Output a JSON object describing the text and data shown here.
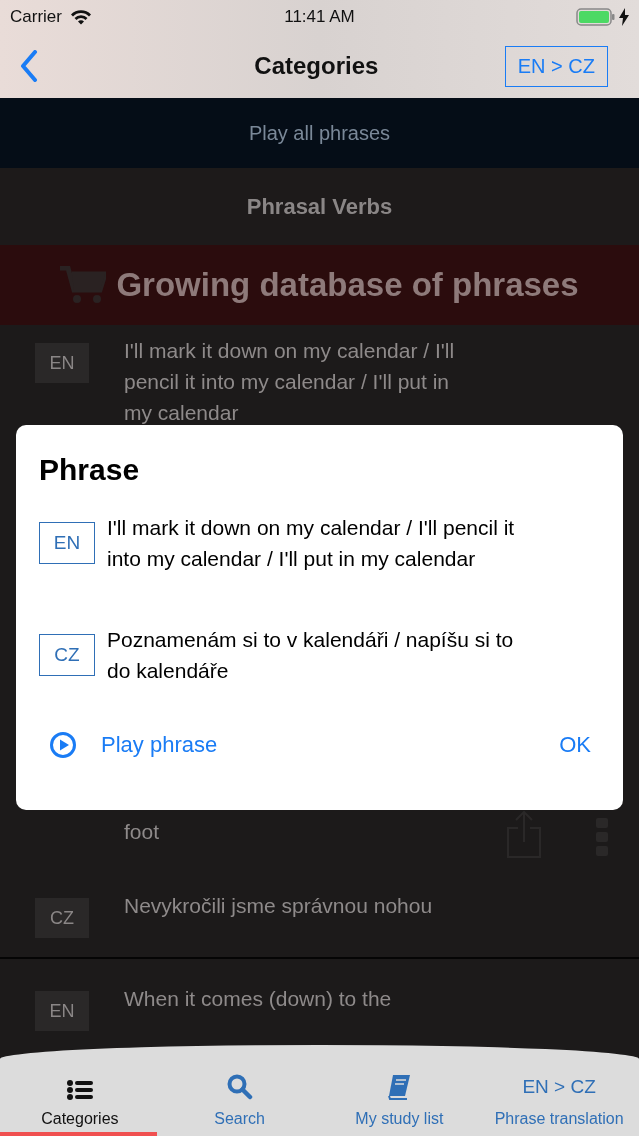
{
  "status_bar": {
    "carrier": "Carrier",
    "time": "11:41 AM"
  },
  "nav": {
    "title": "Categories",
    "language_button": "EN > CZ"
  },
  "list": {
    "play_all": "Play all phrases",
    "category_title": "Phrasal Verbs",
    "promo": "Growing database of phrases"
  },
  "rows": [
    {
      "kind": "entry",
      "lang": "EN",
      "text": "I'll mark it down on my calendar / I'll pencil it into my calendar / I'll put in my calendar"
    },
    {
      "kind": "gap"
    },
    {
      "kind": "tail",
      "text": "foot"
    },
    {
      "kind": "entry",
      "lang": "CZ",
      "text": "Nevykročili jsme správnou nohou"
    },
    {
      "kind": "divider"
    },
    {
      "kind": "entry",
      "lang": "EN",
      "text": "When it comes (down) to the"
    }
  ],
  "dialog": {
    "title": "Phrase",
    "entries": [
      {
        "lang": "EN",
        "text": "I'll mark it down on my calendar / I'll pencil it into my calendar / I'll put in my calendar"
      },
      {
        "lang": "CZ",
        "text": "Poznamenám si to v kalendáři / napíšu si to do kalendáře"
      }
    ],
    "play": "Play phrase",
    "ok": "OK"
  },
  "tab_bar": [
    {
      "kind": "list",
      "label": "Categories",
      "selected": true
    },
    {
      "kind": "search",
      "label": "Search",
      "selected": false
    },
    {
      "kind": "book",
      "label": "My study list",
      "selected": false
    },
    {
      "kind": "text",
      "icon_text": "EN > CZ",
      "label": "Phrase translation",
      "selected": false
    }
  ]
}
